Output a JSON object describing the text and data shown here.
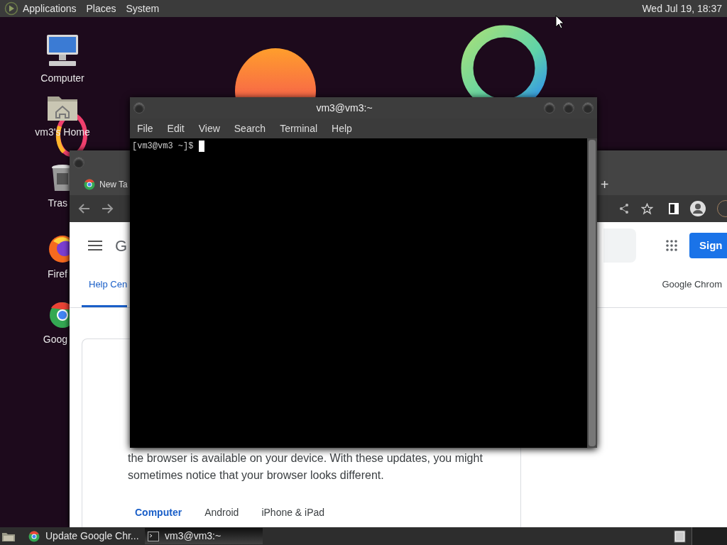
{
  "top_panel": {
    "menus": [
      "Applications",
      "Places",
      "System"
    ],
    "clock": "Wed Jul 19, 18:37"
  },
  "desktop_icons": [
    {
      "label": "Computer",
      "kind": "computer"
    },
    {
      "label": "vm3's Home",
      "kind": "home"
    },
    {
      "label": "Tras",
      "kind": "trash"
    },
    {
      "label": "Firef",
      "kind": "firefox"
    },
    {
      "label": "Goog",
      "kind": "chrome"
    }
  ],
  "browser": {
    "tab": "New Ta",
    "new_tab": "+",
    "logo": "G",
    "sign_in": "Sign",
    "nav_tabs": [
      {
        "label": "Help Cen",
        "selected": true
      },
      {
        "label": "Google Chrom",
        "selected": false
      }
    ],
    "paragraph": "the browser is available on your device. With these updates, you might sometimes notice that your browser looks different.",
    "platform_tabs": [
      {
        "label": "Computer",
        "selected": true
      },
      {
        "label": "Android",
        "selected": false
      },
      {
        "label": "iPhone & iPad",
        "selected": false
      }
    ]
  },
  "terminal": {
    "title": "vm3@vm3:~",
    "menus": [
      "File",
      "Edit",
      "View",
      "Search",
      "Terminal",
      "Help"
    ],
    "prompt": "[vm3@vm3 ~]$"
  },
  "taskbar": {
    "tasks": [
      {
        "label": "Update Google Chr...",
        "kind": "browser",
        "selected": false
      },
      {
        "label": "vm3@vm3:~",
        "kind": "terminal",
        "selected": true
      }
    ]
  }
}
